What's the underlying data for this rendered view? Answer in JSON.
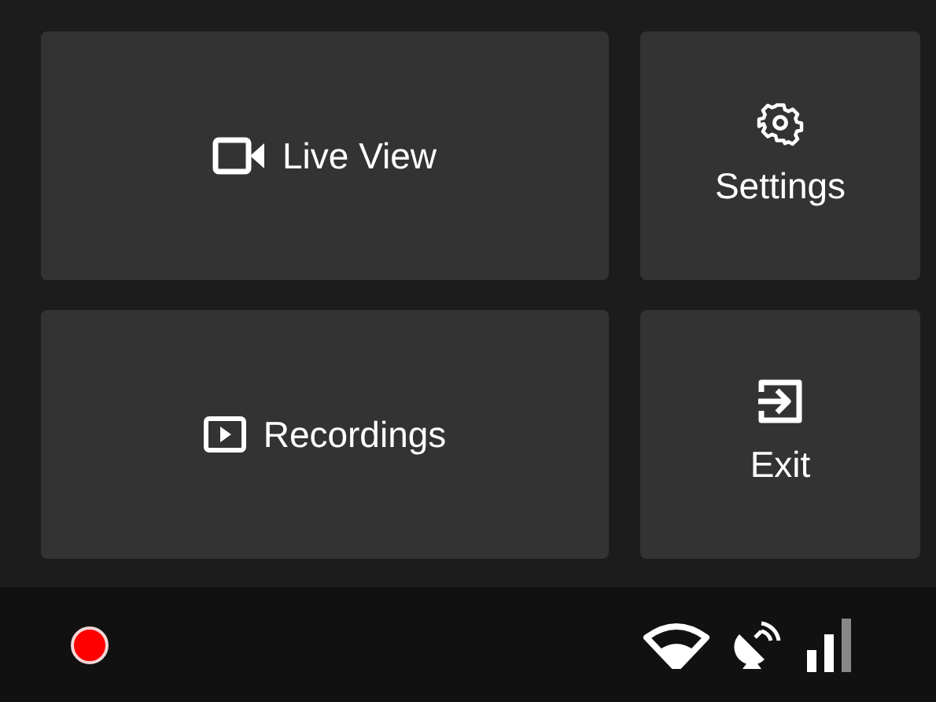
{
  "tiles": [
    {
      "label": "Live View",
      "kind": "row"
    },
    {
      "label": "Settings",
      "kind": "stack"
    },
    {
      "label": "Recordings",
      "kind": "row"
    },
    {
      "label": "Exit",
      "kind": "stack"
    }
  ],
  "status_bar": {
    "recording": true
  }
}
